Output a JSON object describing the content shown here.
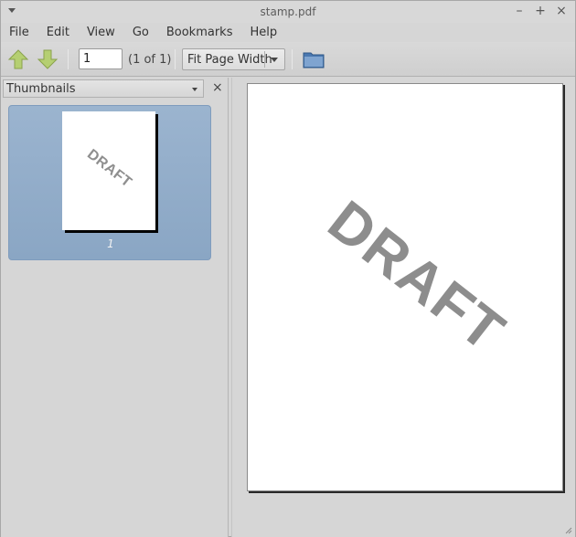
{
  "window": {
    "title": "stamp.pdf",
    "controls": [
      "–",
      "+",
      "×"
    ]
  },
  "menubar": {
    "items": [
      "File",
      "Edit",
      "View",
      "Go",
      "Bookmarks",
      "Help"
    ]
  },
  "toolbar": {
    "page_input_value": "1",
    "page_count": "(1 of 1)",
    "zoom_value": "Fit Page Width"
  },
  "sidebar": {
    "header_label": "Thumbnails",
    "close_glyph": "×",
    "thumbnails": [
      {
        "page_number": "1",
        "stamp_text": "DRAFT",
        "selected": true
      }
    ]
  },
  "document": {
    "stamp_text": "DRAFT"
  },
  "colors": {
    "selection": "#8aa6c4",
    "stamp": "#8d8d8d",
    "arrow_green": "#a9c46a"
  },
  "icons": [
    "window-menu-icon",
    "minimize-icon",
    "maximize-icon",
    "close-icon",
    "go-up-icon",
    "go-down-icon",
    "open-folder-icon",
    "dropdown-arrow-icon",
    "resize-grip-icon"
  ]
}
